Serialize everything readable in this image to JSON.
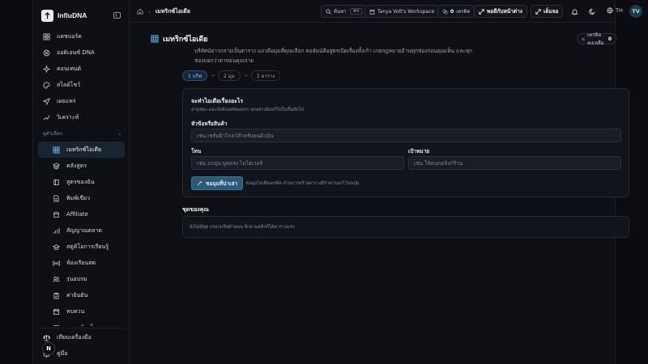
{
  "brand": {
    "name": "InfluDNA"
  },
  "nav": {
    "items": [
      {
        "label": "แดชบอร์ด",
        "icon": "grid-icon"
      },
      {
        "label": "ออดิเอนซ์ DNA",
        "icon": "dna-icon"
      },
      {
        "label": "คอนเทนต์",
        "icon": "sparkle-icon"
      },
      {
        "label": "สไลด์โชว์",
        "icon": "palette-icon"
      },
      {
        "label": "เผยแพร่",
        "icon": "send-icon"
      },
      {
        "label": "วิเคราะห์",
        "icon": "chart-icon"
      }
    ],
    "section_label": "ดูตัวเลือก",
    "sub_items": [
      {
        "label": "เมทริกซ์ไอเดีย",
        "icon": "matrix-icon",
        "active": true
      },
      {
        "label": "คลังสูตร",
        "icon": "layers-icon"
      },
      {
        "label": "สูตรของฉัน",
        "icon": "book-icon"
      },
      {
        "label": "พิมพ์เขียว",
        "icon": "doc-icon"
      },
      {
        "label": "Affiliate",
        "icon": "store-icon"
      },
      {
        "label": "สัญญาณตลาด",
        "icon": "signal-icon"
      },
      {
        "label": "สตูดิโอการเรียนรู้",
        "icon": "cap-icon"
      },
      {
        "label": "ห้องเรียนสด",
        "icon": "broadcast-icon"
      },
      {
        "label": "รุ่นอบรม",
        "icon": "users-icon"
      },
      {
        "label": "ค่ายินยัน",
        "icon": "clipboard-icon"
      },
      {
        "label": "ทบทวน",
        "icon": "calendar-icon"
      },
      {
        "label": "ความคิดเห็น",
        "icon": "chat-icon"
      }
    ],
    "bottom_items": [
      {
        "label": "เทียบเครื่องมือ",
        "icon": "scale-icon"
      },
      {
        "label": "คู่มือ",
        "icon": "help-icon"
      }
    ],
    "n_badge": "N"
  },
  "topbar": {
    "breadcrumb_current": "เมทริกซ์ไอเดีย",
    "search_label": "ค้นหา",
    "search_kbd": "⌘K",
    "workspace": "Tanya Volt's Workspace",
    "credits_count": "0",
    "credits_label": "เครดิต",
    "pop_label": "พอดีกับหน้าต่าง",
    "full_label": "เต็มจอ",
    "lang": "TH",
    "avatar": "TV"
  },
  "page": {
    "title": "เมทริกซ์ไอเดีย",
    "credit_label": "เครดิตคงเหลือ",
    "credit_value": "0",
    "description": "บริหัศน์ยาวกลายเป็นตาราง แถวคือมุมที่คุณเลือก คอลัมน์คือสูตรเปิดเรื่องทั้งเก้า เกตกฎหมายอ้านทุกช่องก่อนคุณเห็น และทุกช่องบอกว่าตาท่อนคุณจ่าย",
    "steps": [
      "1 บรีฟ",
      "2 มุม",
      "3 ตาราง"
    ],
    "form": {
      "title": "จะทำไอเดียเรื่องอะไร",
      "subtitle": "สามช่อง และบังคับแค่ช่องแรก ทุกอย่างยังแก้ไขในขั้นถัดไป",
      "product_label": "หัวข้อหรือสินค้า",
      "product_placeholder": "เช่น เซรั่มผิวโกลว์สำหรับคนผิวมัน",
      "tone_label": "โทน",
      "tone_placeholder": "เช่น อบอุ่น พูดตรง ไม่ไฮเวอร์",
      "goal_label": "เป้าหมาย",
      "goal_placeholder": "เช่น ให้คนกดลิงก์ร้าน",
      "submit_label": "ชอมุมที่น่าเล่า",
      "submit_note": "ชอมุมไม่เสียเครดิต ส่วนการสร้างตารางมีราคาบอกไว้บนปุ่ม"
    },
    "sets_title": "ชุดของคุณ",
    "sets_empty": "ยังไม่มีชุด กรอกบรีฟด้านบน อีกสามคลิกก็ได้ตารางแรก"
  },
  "colors": {
    "accent": "#6fb3e8",
    "button": "#2b5a77",
    "background": "#0e1016"
  }
}
